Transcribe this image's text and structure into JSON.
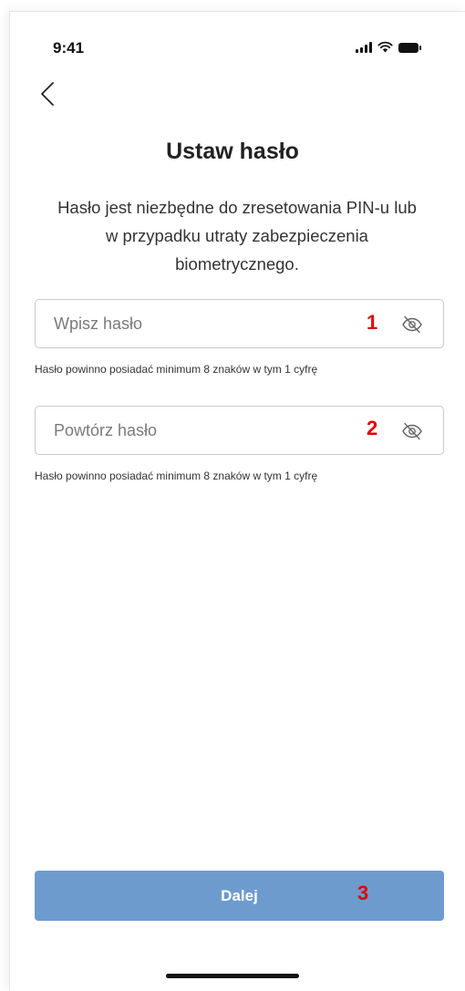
{
  "status_bar": {
    "time": "9:41"
  },
  "header": {
    "title": "Ustaw hasło"
  },
  "intro": {
    "text": "Hasło jest niezbędne do zresetowania PIN-u lub w przypadku utraty zabezpieczenia biometrycznego."
  },
  "form": {
    "password": {
      "placeholder": "Wpisz hasło",
      "value": "",
      "marker": "1",
      "hint": "Hasło powinno posiadać minimum 8 znaków w tym 1 cyfrę"
    },
    "repeat_password": {
      "placeholder": "Powtórz hasło",
      "value": "",
      "marker": "2",
      "hint": "Hasło powinno posiadać minimum 8 znaków w tym 1 cyfrę"
    }
  },
  "actions": {
    "next_label": "Dalej",
    "next_marker": "3"
  },
  "colors": {
    "primary": "#6e9bcd",
    "marker": "#e00000"
  },
  "icons": {
    "back": "chevron-left-icon",
    "visibility": "eye-off-icon"
  }
}
